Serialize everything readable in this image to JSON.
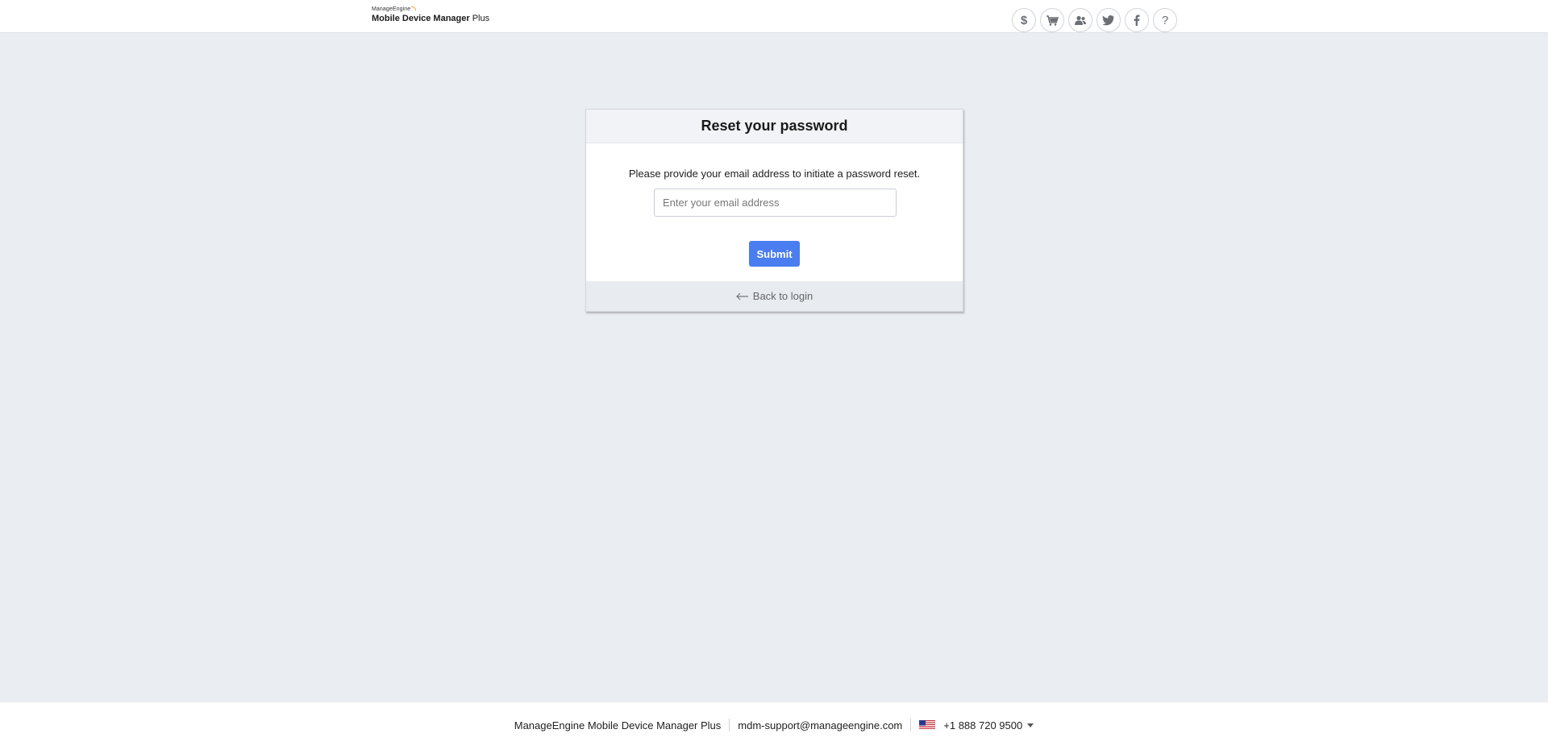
{
  "header": {
    "logo_brand": "ManageEngine",
    "logo_product": "Mobile Device Manager",
    "logo_suffix": "Plus",
    "icons": [
      "dollar-icon",
      "cart-icon",
      "users-icon",
      "twitter-icon",
      "facebook-icon",
      "help-icon"
    ]
  },
  "card": {
    "title": "Reset your password",
    "instruction": "Please provide your email address to initiate a password reset.",
    "email_placeholder": "Enter your email address",
    "email_value": "",
    "submit_label": "Submit",
    "back_label": "Back to login"
  },
  "footer": {
    "product_name": "ManageEngine Mobile Device Manager Plus",
    "support_email": "mdm-support@manageengine.com",
    "phone": "+1 888 720 9500",
    "region_flag": "us-flag-icon"
  },
  "colors": {
    "accent": "#4a7df0",
    "background": "#eaedf1",
    "card_header": "#f1f3f7",
    "card_footer": "#e8ebf0",
    "logo_arc": "#e99a2c"
  }
}
